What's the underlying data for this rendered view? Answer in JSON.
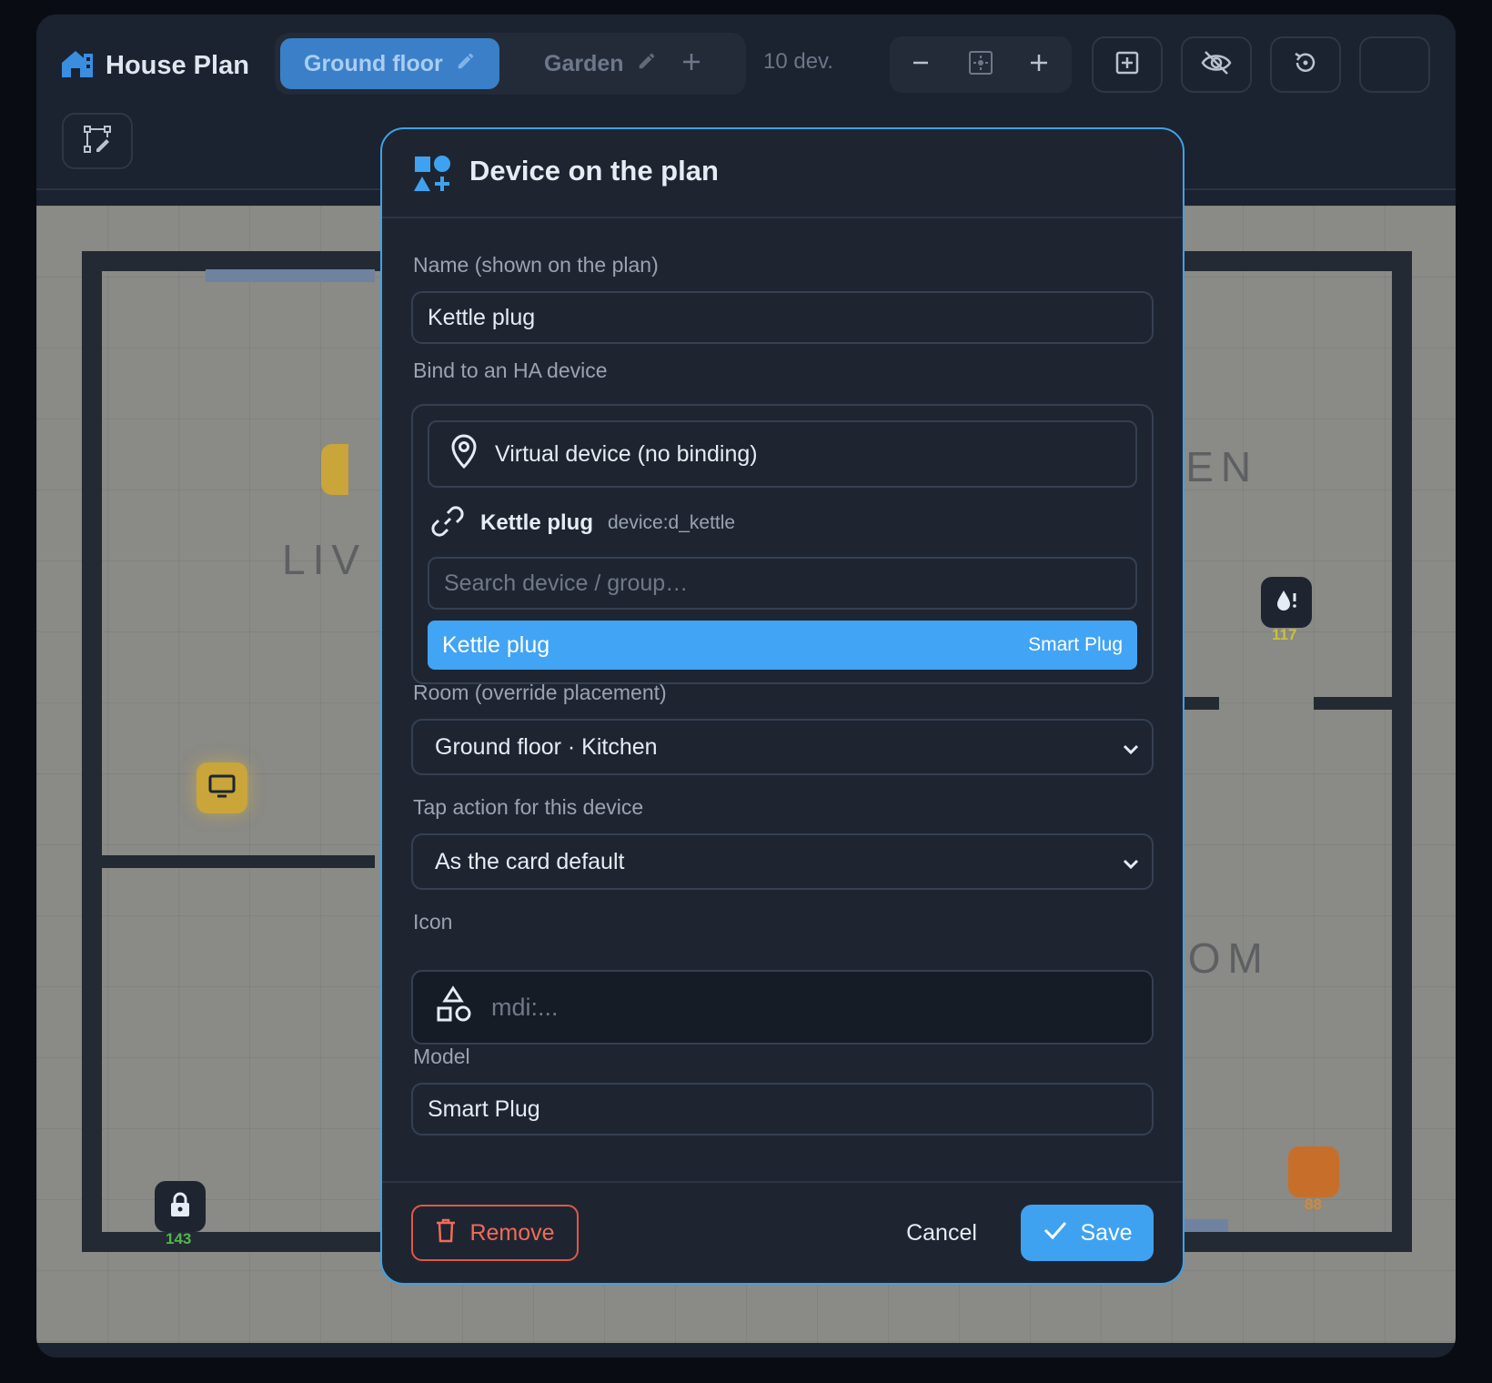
{
  "colors": {
    "accent": "#3ea2f0",
    "danger": "#f06b5b",
    "background": "#1b2230",
    "selected_result": "#42a4f5"
  },
  "header": {
    "title": "House Plan",
    "tabs": [
      {
        "label": "Ground floor",
        "active": true
      },
      {
        "label": "Garden",
        "active": false
      }
    ],
    "device_count": "10 dev.",
    "icons": [
      "home-icon",
      "pencil-icon",
      "plus-icon",
      "minus-icon",
      "fit-screen-icon",
      "add-box-icon",
      "eye-off-icon",
      "restore-icon",
      "edit-shape-icon"
    ]
  },
  "plan": {
    "rooms": [
      "LIV",
      "HEN",
      "OOM"
    ],
    "devices": [
      {
        "icon": "tv-icon",
        "label": ""
      },
      {
        "icon": "water-alert-icon",
        "label": "117"
      },
      {
        "icon": "lock-icon",
        "label": "143"
      },
      {
        "icon": "plug-icon",
        "label": "88"
      }
    ]
  },
  "modal": {
    "title": "Device on the plan",
    "name_label": "Name (shown on the plan)",
    "name_value": "Kettle plug",
    "bind_label": "Bind to an HA device",
    "virtual_option": "Virtual device (no binding)",
    "bound_name": "Kettle plug",
    "bound_id": "device:d_kettle",
    "search_placeholder": "Search device / group…",
    "result": {
      "name": "Kettle plug",
      "type": "Smart Plug"
    },
    "room_label": "Room (override placement)",
    "room_value": "Ground floor · Kitchen",
    "tap_label": "Tap action for this device",
    "tap_value": "As the card default",
    "icon_label": "Icon",
    "icon_placeholder": "mdi:...",
    "model_label": "Model",
    "model_value": "Smart Plug",
    "remove_label": "Remove",
    "cancel_label": "Cancel",
    "save_label": "Save"
  }
}
